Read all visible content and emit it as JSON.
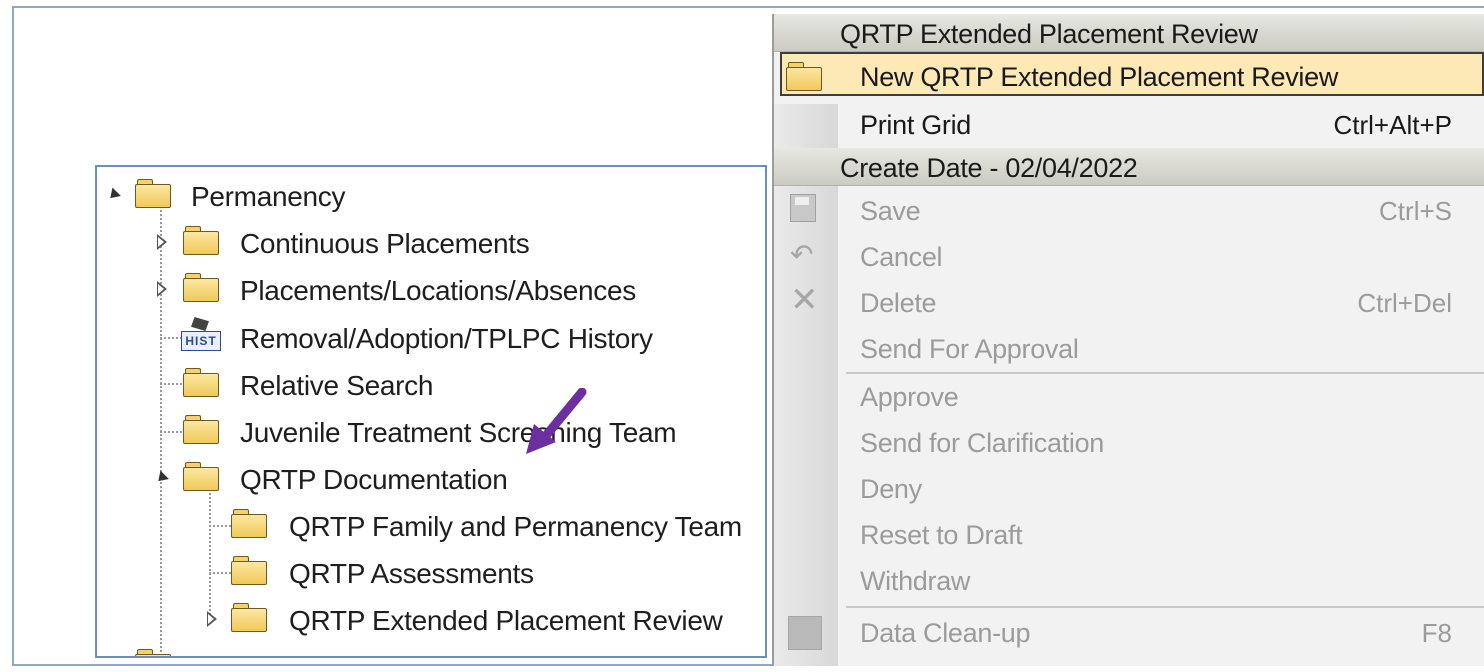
{
  "tree": {
    "items": [
      {
        "label": "Permanency",
        "icon": "folder-icon",
        "expander": "expanded"
      },
      {
        "label": "Continuous Placements",
        "icon": "folder-icon",
        "expander": "collapsed"
      },
      {
        "label": "Placements/Locations/Absences",
        "icon": "folder-icon",
        "expander": "collapsed"
      },
      {
        "label": "Removal/Adoption/TPLPC History",
        "icon": "history-icon",
        "expander": "none"
      },
      {
        "label": "Relative Search",
        "icon": "folder-icon",
        "expander": "none"
      },
      {
        "label": "Juvenile Treatment Screening Team",
        "icon": "folder-icon",
        "expander": "none"
      },
      {
        "label": "QRTP Documentation",
        "icon": "folder-icon",
        "expander": "expanded"
      },
      {
        "label": "QRTP Family and Permanency Team",
        "icon": "folder-icon",
        "expander": "none"
      },
      {
        "label": "QRTP Assessments",
        "icon": "folder-icon",
        "expander": "none"
      },
      {
        "label": "QRTP Extended Placement Review",
        "icon": "folder-icon",
        "expander": "collapsed"
      }
    ],
    "history_icon_text": "HIST"
  },
  "menu": {
    "header1": "QRTP Extended Placement Review",
    "new_item": "New QRTP Extended Placement Review",
    "print_grid": {
      "label": "Print Grid",
      "shortcut": "Ctrl+Alt+P"
    },
    "header2": "Create Date - 02/04/2022",
    "save": {
      "label": "Save",
      "shortcut": "Ctrl+S"
    },
    "cancel": {
      "label": "Cancel"
    },
    "delete": {
      "label": "Delete",
      "shortcut": "Ctrl+Del"
    },
    "send_for_approval": {
      "label": "Send For Approval"
    },
    "approve": {
      "label": "Approve"
    },
    "send_for_clarification": {
      "label": "Send for Clarification"
    },
    "deny": {
      "label": "Deny"
    },
    "reset_to_draft": {
      "label": "Reset to Draft"
    },
    "withdraw": {
      "label": "Withdraw"
    },
    "data_cleanup": {
      "label": "Data Clean-up",
      "shortcut": "F8"
    }
  },
  "colors": {
    "highlight": "#fde9b6",
    "arrow": "#6b2fa0",
    "disabled_text": "#9b9b9b"
  }
}
